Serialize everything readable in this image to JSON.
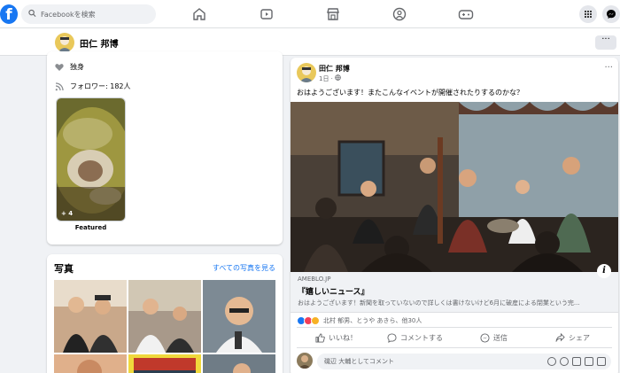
{
  "app": {
    "brand_letter": "f",
    "brand_color": "#1877f2"
  },
  "search": {
    "placeholder": "Facebookを検索"
  },
  "nav": {
    "icons": [
      "home-icon",
      "watch-icon",
      "marketplace-icon",
      "groups-icon",
      "gaming-icon"
    ],
    "right_icons": [
      "menu-grid-icon",
      "messenger-icon"
    ]
  },
  "profile_bar": {
    "name": "田仁 邦博",
    "more": "···"
  },
  "intro": {
    "status_label": "独身",
    "followers_label": "フォロワー: 182人"
  },
  "featured": {
    "count_badge": "+ 4",
    "label": "Featured"
  },
  "photos": {
    "title": "写真",
    "see_all": "すべての写真を見る"
  },
  "post": {
    "author": "田仁 邦博",
    "time": "1日 · ",
    "privacy_icon": "globe-icon",
    "more": "···",
    "text": "おはようございます！またこんなイベントが開催されたりするのかな？",
    "link": {
      "domain": "AMEBLO.JP",
      "title": "『嬉しいニュース』",
      "description": "おはようございます！新聞を取っていないので詳しくは書けないけど6月に破産による閉業という完..."
    },
    "reactions_text": "北村 郁男、とうや あきら、他30人",
    "actions": {
      "like": "いいね！",
      "comment": "コメントする",
      "send": "送信",
      "share": "シェア"
    },
    "comment_placeholder": "磯辺 大輔としてコメント",
    "info": "i"
  }
}
